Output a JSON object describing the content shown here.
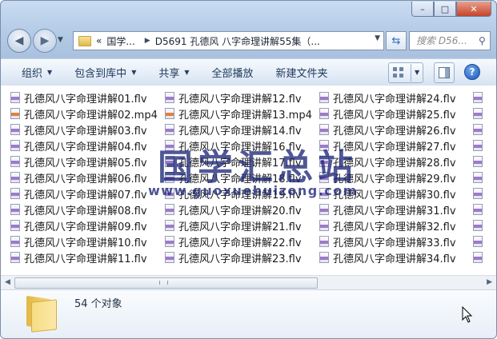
{
  "window": {
    "caption_buttons": {
      "minimize": "–",
      "maximize": "□",
      "close": "✕"
    }
  },
  "nav": {
    "back_glyph": "◀",
    "forward_glyph": "▶",
    "address": {
      "overflow": "«",
      "crumb1": "国学...",
      "crumb2": "D5691 孔德风 八字命理讲解55集（..."
    },
    "search_placeholder": "搜索 D56..."
  },
  "toolbar": {
    "organize": "组织",
    "include_library": "包含到库中",
    "share": "共享",
    "play_all": "全部播放",
    "new_folder": "新建文件夹"
  },
  "files": {
    "col1": [
      {
        "name": "孔德风八字命理讲解01.flv",
        "type": "flv"
      },
      {
        "name": "孔德风八字命理讲解02.mp4",
        "type": "mp4"
      },
      {
        "name": "孔德风八字命理讲解03.flv",
        "type": "flv"
      },
      {
        "name": "孔德风八字命理讲解04.flv",
        "type": "flv"
      },
      {
        "name": "孔德风八字命理讲解05.flv",
        "type": "flv"
      },
      {
        "name": "孔德风八字命理讲解06.flv",
        "type": "flv"
      },
      {
        "name": "孔德风八字命理讲解07.flv",
        "type": "flv"
      },
      {
        "name": "孔德风八字命理讲解08.flv",
        "type": "flv"
      },
      {
        "name": "孔德风八字命理讲解09.flv",
        "type": "flv"
      },
      {
        "name": "孔德风八字命理讲解10.flv",
        "type": "flv"
      },
      {
        "name": "孔德风八字命理讲解11.flv",
        "type": "flv"
      }
    ],
    "col2": [
      {
        "name": "孔德风八字命理讲解12.flv",
        "type": "flv"
      },
      {
        "name": "孔德风八字命理讲解13.mp4",
        "type": "mp4"
      },
      {
        "name": "孔德风八字命理讲解14.flv",
        "type": "flv"
      },
      {
        "name": "孔德风八字命理讲解16.flv",
        "type": "flv"
      },
      {
        "name": "孔德风八字命理讲解17.flv",
        "type": "flv"
      },
      {
        "name": "孔德风八字命理讲解18.flv",
        "type": "flv"
      },
      {
        "name": "孔德风八字命理讲解19.flv",
        "type": "flv"
      },
      {
        "name": "孔德风八字命理讲解20.flv",
        "type": "flv"
      },
      {
        "name": "孔德风八字命理讲解21.flv",
        "type": "flv"
      },
      {
        "name": "孔德风八字命理讲解22.flv",
        "type": "flv"
      },
      {
        "name": "孔德风八字命理讲解23.flv",
        "type": "flv"
      }
    ],
    "col3": [
      {
        "name": "孔德风八字命理讲解24.flv",
        "type": "flv"
      },
      {
        "name": "孔德风八字命理讲解25.flv",
        "type": "flv"
      },
      {
        "name": "孔德风八字命理讲解26.flv",
        "type": "flv"
      },
      {
        "name": "孔德风八字命理讲解27.flv",
        "type": "flv"
      },
      {
        "name": "孔德风八字命理讲解28.flv",
        "type": "flv"
      },
      {
        "name": "孔德风八字命理讲解29.flv",
        "type": "flv"
      },
      {
        "name": "孔德风八字命理讲解30.flv",
        "type": "flv"
      },
      {
        "name": "孔德风八字命理讲解31.flv",
        "type": "flv"
      },
      {
        "name": "孔德风八字命理讲解32.flv",
        "type": "flv"
      },
      {
        "name": "孔德风八字命理讲解33.flv",
        "type": "flv"
      },
      {
        "name": "孔德风八字命理讲解34.flv",
        "type": "flv"
      }
    ]
  },
  "watermark": {
    "title": "国学汇总站",
    "url": "www.guoxuehuizong.com"
  },
  "details": {
    "count": "54 个对象"
  },
  "colors": {
    "toolbar_text": "#1e395b",
    "watermark": "#1e2878",
    "flv_badge": "#9c7bc8",
    "mp4_badge": "#e0823a"
  }
}
